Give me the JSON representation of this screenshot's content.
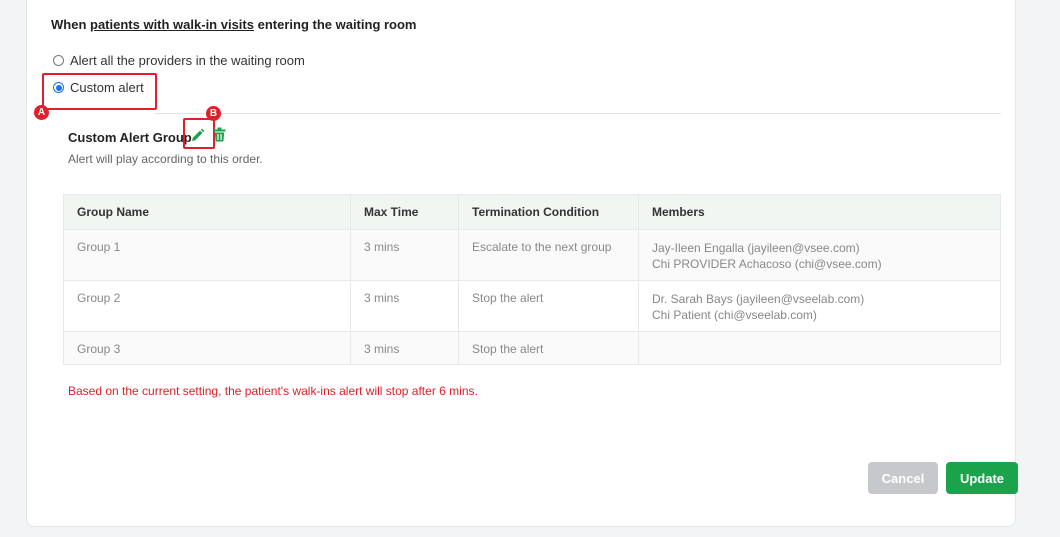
{
  "header": {
    "prefix": "When ",
    "link": "patients with walk-in visits",
    "suffix": " entering the waiting room"
  },
  "options": [
    {
      "label": "Alert all the providers in the waiting room",
      "checked": false
    },
    {
      "label": "Custom alert",
      "checked": true
    }
  ],
  "markers": {
    "a": "A",
    "b": "B"
  },
  "group": {
    "title": "Custom Alert Group",
    "subtitle": "Alert will play according to this order.",
    "icons": [
      "pencil-icon",
      "trash-icon"
    ]
  },
  "table": {
    "headers": [
      "Group Name",
      "Max Time",
      "Termination Condition",
      "Members"
    ],
    "rows": [
      {
        "name": "Group 1",
        "time": "3 mins",
        "condition": "Escalate to the next group",
        "members": [
          "Jay-Ileen Engalla (jayileen@vsee.com)",
          "Chi PROVIDER Achacoso (chi@vsee.com)"
        ]
      },
      {
        "name": "Group 2",
        "time": "3 mins",
        "condition": "Stop the alert",
        "members": [
          "Dr. Sarah Bays (jayileen@vseelab.com)",
          "Chi Patient (chi@vseelab.com)"
        ]
      },
      {
        "name": "Group 3",
        "time": "3 mins",
        "condition": "Stop the alert",
        "members": []
      }
    ]
  },
  "warning": "Based on the current setting, the patient's walk-ins alert will stop after 6 mins.",
  "buttons": {
    "cancel": "Cancel",
    "update": "Update"
  },
  "colors": {
    "highlight": "#e0202a",
    "accent_green": "#1aa34a",
    "radio_blue": "#1a73e8"
  }
}
